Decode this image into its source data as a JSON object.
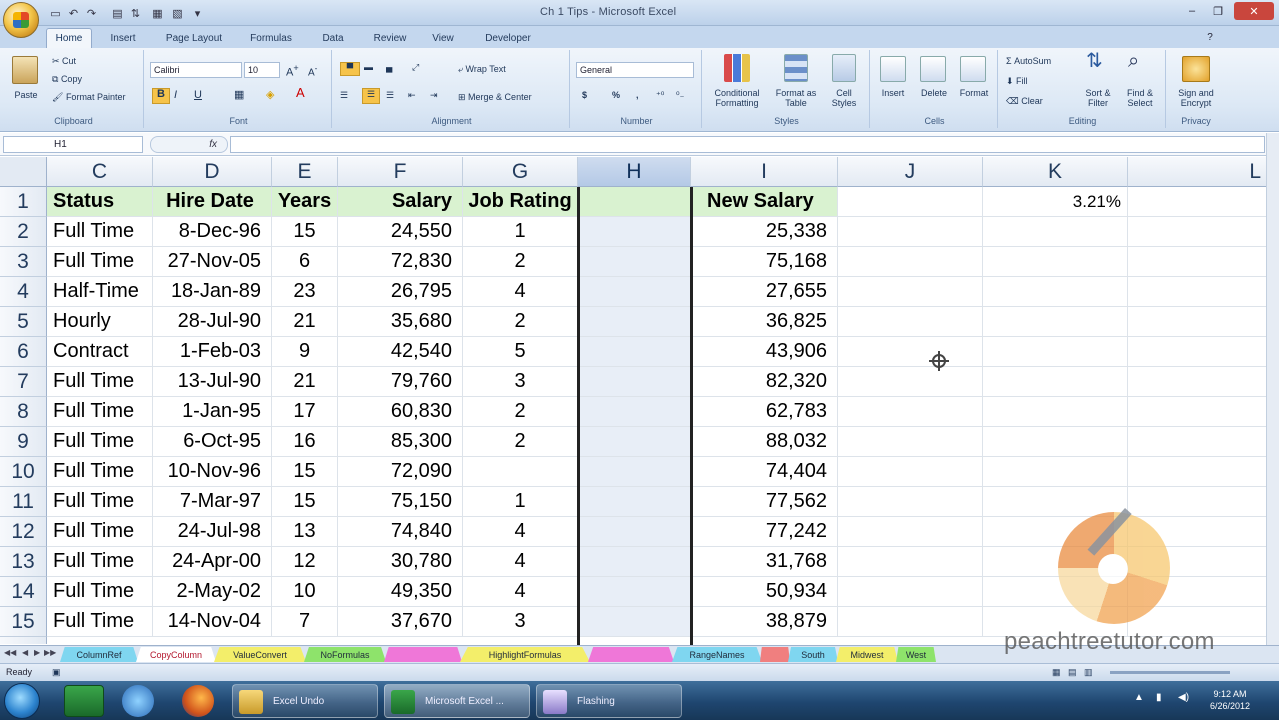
{
  "window": {
    "title": "Ch 1 Tips - Microsoft Excel",
    "minimize": "–",
    "maximize": "❐",
    "close": "✕"
  },
  "ribbon_tabs": [
    "Home",
    "Insert",
    "Page Layout",
    "Formulas",
    "Data",
    "Review",
    "View",
    "Developer"
  ],
  "ribbon": {
    "clipboard": {
      "paste": "Paste",
      "cut": "Cut",
      "copy": "Copy",
      "format_painter": "Format Painter",
      "name": "Clipboard"
    },
    "font": {
      "family": "Calibri",
      "size": "10",
      "name": "Font"
    },
    "alignment": {
      "wrap": "Wrap Text",
      "merge": "Merge & Center",
      "name": "Alignment"
    },
    "number": {
      "format": "General",
      "name": "Number"
    },
    "styles": {
      "conditional": "Conditional Formatting",
      "as_table": "Format as Table",
      "cell_styles": "Cell Styles",
      "name": "Styles"
    },
    "cells": {
      "insert": "Insert",
      "delete": "Delete",
      "format": "Format",
      "name": "Cells"
    },
    "editing": {
      "autosum": "AutoSum",
      "fill": "Fill",
      "clear": "Clear",
      "sort": "Sort & Filter",
      "find": "Find & Select",
      "name": "Editing"
    },
    "privacy": {
      "sign": "Sign and Encrypt",
      "name": "Privacy"
    }
  },
  "formula_bar": {
    "name_box": "H1",
    "fx": "fx",
    "formula": ""
  },
  "columns": [
    "C",
    "D",
    "E",
    "F",
    "G",
    "H",
    "I",
    "J",
    "K",
    "L"
  ],
  "header_row": {
    "row": "1",
    "C": "Status",
    "D": "Hire Date",
    "E": "Years",
    "F": "Salary",
    "G": "Job Rating",
    "H": "",
    "I": "New Salary",
    "J": "",
    "K": "3.21%"
  },
  "rows": [
    {
      "row": "2",
      "C": "Full Time",
      "D": "8-Dec-96",
      "E": "15",
      "F": "24,550",
      "G": "1",
      "I": "25,338"
    },
    {
      "row": "3",
      "C": "Full Time",
      "D": "27-Nov-05",
      "E": "6",
      "F": "72,830",
      "G": "2",
      "I": "75,168"
    },
    {
      "row": "4",
      "C": "Half-Time",
      "D": "18-Jan-89",
      "E": "23",
      "F": "26,795",
      "G": "4",
      "I": "27,655"
    },
    {
      "row": "5",
      "C": "Hourly",
      "D": "28-Jul-90",
      "E": "21",
      "F": "35,680",
      "G": "2",
      "I": "36,825"
    },
    {
      "row": "6",
      "C": "Contract",
      "D": "1-Feb-03",
      "E": "9",
      "F": "42,540",
      "G": "5",
      "I": "43,906"
    },
    {
      "row": "7",
      "C": "Full Time",
      "D": "13-Jul-90",
      "E": "21",
      "F": "79,760",
      "G": "3",
      "I": "82,320"
    },
    {
      "row": "8",
      "C": "Full Time",
      "D": "1-Jan-95",
      "E": "17",
      "F": "60,830",
      "G": "2",
      "I": "62,783"
    },
    {
      "row": "9",
      "C": "Full Time",
      "D": "6-Oct-95",
      "E": "16",
      "F": "85,300",
      "G": "2",
      "I": "88,032"
    },
    {
      "row": "10",
      "C": "Full Time",
      "D": "10-Nov-96",
      "E": "15",
      "F": "72,090",
      "G": "",
      "I": "74,404"
    },
    {
      "row": "11",
      "C": "Full Time",
      "D": "7-Mar-97",
      "E": "15",
      "F": "75,150",
      "G": "1",
      "I": "77,562"
    },
    {
      "row": "12",
      "C": "Full Time",
      "D": "24-Jul-98",
      "E": "13",
      "F": "74,840",
      "G": "4",
      "I": "77,242"
    },
    {
      "row": "13",
      "C": "Full Time",
      "D": "24-Apr-00",
      "E": "12",
      "F": "30,780",
      "G": "4",
      "I": "31,768"
    },
    {
      "row": "14",
      "C": "Full Time",
      "D": "2-May-02",
      "E": "10",
      "F": "49,350",
      "G": "4",
      "I": "50,934"
    },
    {
      "row": "15",
      "C": "Full Time",
      "D": "14-Nov-04",
      "E": "7",
      "F": "37,670",
      "G": "3",
      "I": "38,879"
    }
  ],
  "sheet_tabs": [
    {
      "label": "ColumnRef",
      "color": "#7fd6f0"
    },
    {
      "label": "CopyColumn",
      "color": "#ffffff",
      "active": true
    },
    {
      "label": "ValueConvert",
      "color": "#f3ee6a"
    },
    {
      "label": "NoFormulas",
      "color": "#8ee36b"
    },
    {
      "label": "",
      "color": "#ef77d8"
    },
    {
      "label": "HighlightFormulas",
      "color": "#f3ee6a"
    },
    {
      "label": "",
      "color": "#ef77d8"
    },
    {
      "label": "RangeNames",
      "color": "#7fd6f0"
    },
    {
      "label": "",
      "color": "#f07f7f"
    },
    {
      "label": "South",
      "color": "#7fd6f0"
    },
    {
      "label": "Midwest",
      "color": "#f3ee6a"
    },
    {
      "label": "West",
      "color": "#8ee36b"
    }
  ],
  "status": {
    "text": "Ready"
  },
  "taskbar": {
    "windows": [
      "Excel Undo",
      "Microsoft Excel ...",
      "Flashing"
    ],
    "time": "9:12 AM",
    "date": "6/26/2012"
  },
  "watermark": {
    "text": "peachtreetutor.com"
  }
}
